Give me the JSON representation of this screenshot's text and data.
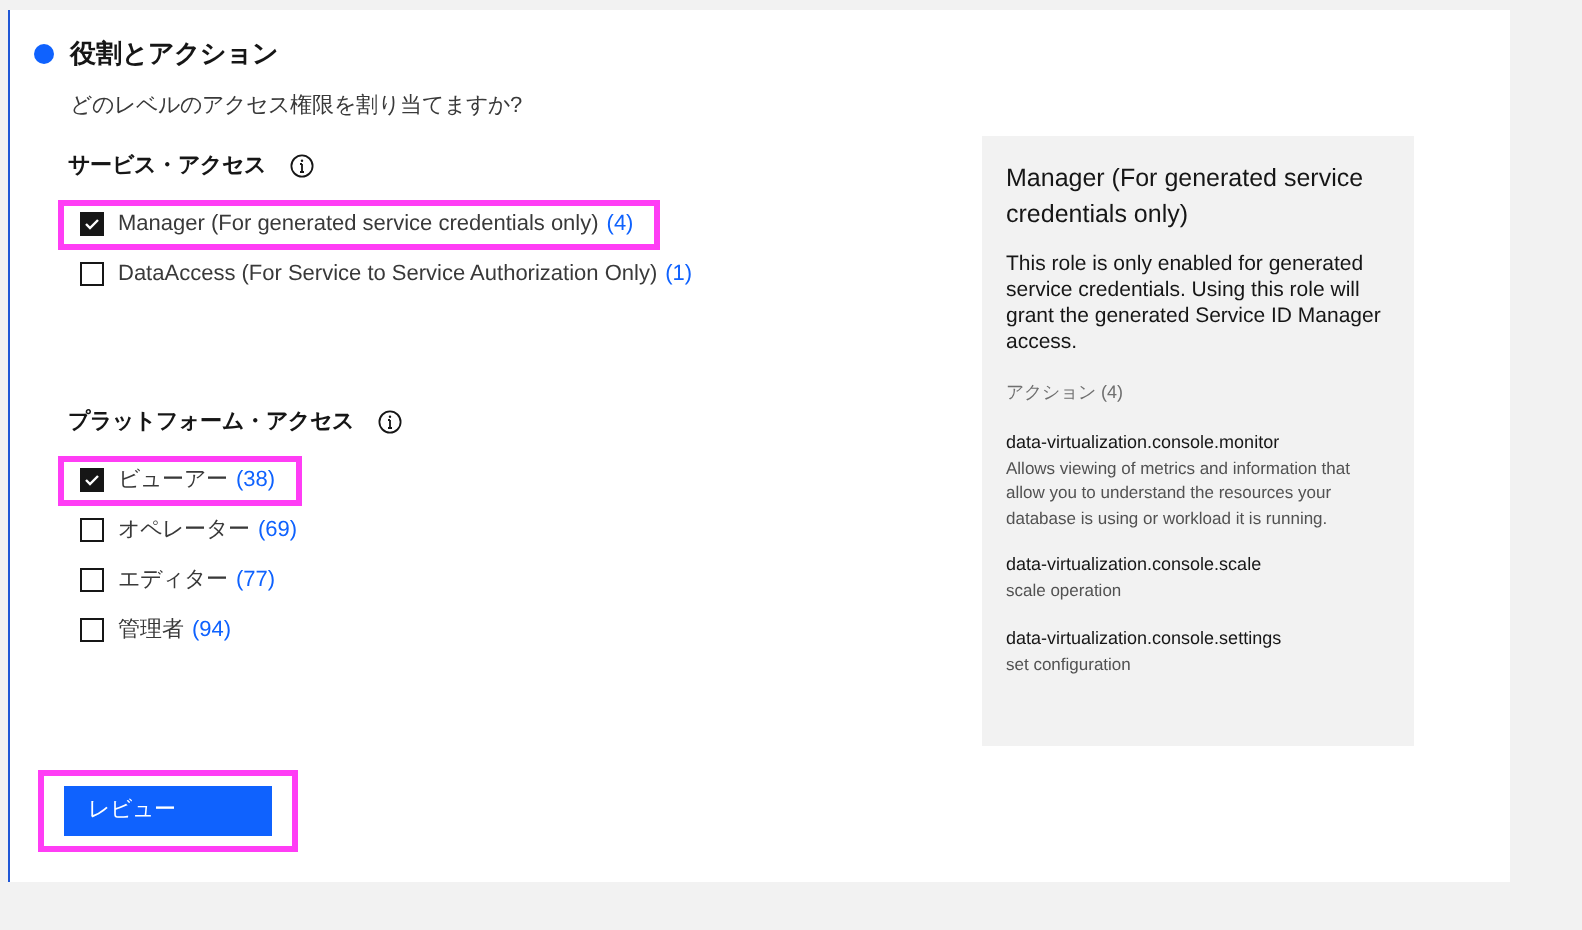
{
  "section": {
    "title": "役割とアクション",
    "question": "どのレベルのアクセス権限を割り当てますか?"
  },
  "groups": [
    {
      "heading": "サービス・アクセス",
      "options": [
        {
          "label": "Manager (For generated service credentials only)",
          "count": "(4)",
          "checked": true,
          "highlighted": true
        },
        {
          "label": "DataAccess (For Service to Service Authorization Only)",
          "count": "(1)",
          "checked": false,
          "highlighted": false
        }
      ]
    },
    {
      "heading": "プラットフォーム・アクセス",
      "options": [
        {
          "label": "ビューアー",
          "count": "(38)",
          "checked": true,
          "highlighted": true
        },
        {
          "label": "オペレーター",
          "count": "(69)",
          "checked": false,
          "highlighted": false
        },
        {
          "label": "エディター",
          "count": "(77)",
          "checked": false,
          "highlighted": false
        },
        {
          "label": "管理者",
          "count": "(94)",
          "checked": false,
          "highlighted": false
        }
      ]
    }
  ],
  "details": {
    "title": "Manager (For generated service credentials only)",
    "description": "This role is only enabled for generated service credentials. Using this role will grant the generated Service ID Manager access.",
    "actions_heading": "アクション (4)",
    "actions": [
      {
        "name": "data-virtualization.console.monitor",
        "description": "Allows viewing of metrics and information that allow you to understand the resources your database is using or workload it is running."
      },
      {
        "name": "data-virtualization.console.scale",
        "description": "scale operation"
      },
      {
        "name": "data-virtualization.console.settings",
        "description": "set configuration"
      }
    ]
  },
  "review_button": {
    "label": "レビュー",
    "highlighted": true
  }
}
